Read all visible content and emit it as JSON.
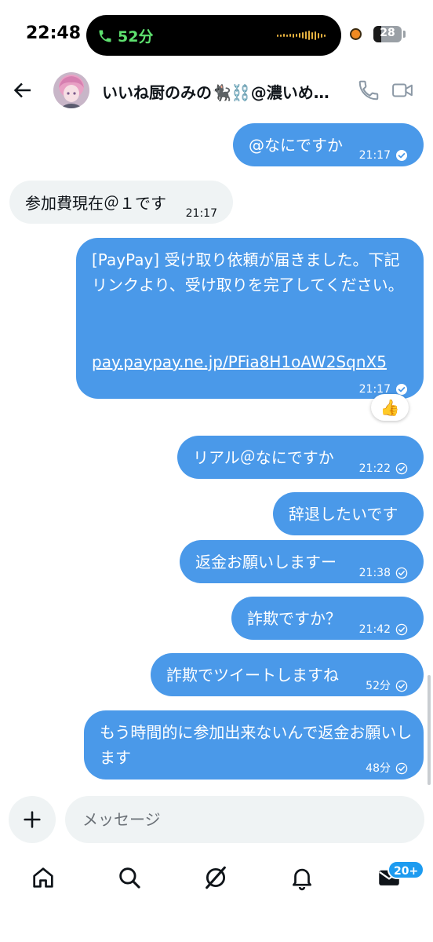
{
  "status_bar": {
    "time": "22:48",
    "call_duration": "52分",
    "battery": "28"
  },
  "header": {
    "contact_name": "いいね厨のみの🐈‍⬛⛓️@濃いめ…"
  },
  "messages": [
    {
      "dir": "out",
      "text": "@なにですか",
      "time": "21:17",
      "status": "read"
    },
    {
      "dir": "in",
      "text": "参加費現在＠１です",
      "time": "21:17"
    },
    {
      "dir": "out",
      "text": "[PayPay] 受け取り依頼が届きました。下記リンクより、受け取りを完了してください。",
      "link": "pay.paypay.ne.jp/PFia8H1oAW2SqnX5",
      "time": "21:17",
      "status": "read",
      "reaction": "👍"
    },
    {
      "dir": "out",
      "text": "リアル＠なにですか",
      "time": "21:22",
      "status": "sent"
    },
    {
      "dir": "out",
      "text": "辞退したいです",
      "time": "",
      "status": ""
    },
    {
      "dir": "out",
      "text": "返金お願いしますー",
      "time": "21:38",
      "status": "sent"
    },
    {
      "dir": "out",
      "text": "詐欺ですか？",
      "time": "21:42",
      "status": "sent"
    },
    {
      "dir": "out",
      "text": "詐欺でツイートしますね",
      "time": "52分",
      "status": "sent"
    },
    {
      "dir": "out",
      "text": "もう時間的に参加出来ないんで返金お願いします",
      "time": "48分",
      "status": "sent"
    }
  ],
  "composer": {
    "placeholder": "メッセージ"
  },
  "nav": {
    "items": [
      "home-icon",
      "search-icon",
      "grok-icon",
      "notifications-icon",
      "messages-icon"
    ],
    "messages_badge": "20+"
  },
  "colors": {
    "outgoing_bubble": "#4a99e9",
    "incoming_bubble": "#eff3f4",
    "accent": "#1d9bf0"
  }
}
